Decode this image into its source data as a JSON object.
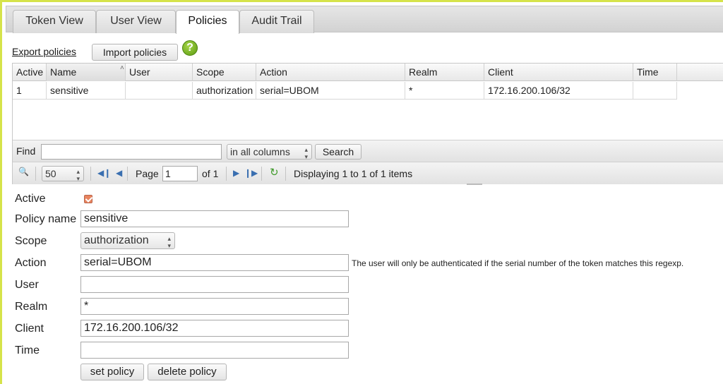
{
  "tabs": [
    {
      "label": "Token View",
      "active": false
    },
    {
      "label": "User View",
      "active": false
    },
    {
      "label": "Policies",
      "active": true
    },
    {
      "label": "Audit Trail",
      "active": false
    }
  ],
  "toolbar": {
    "export_label": "Export policies",
    "import_label": "Import policies",
    "help_icon": "help-icon",
    "help_glyph": "?"
  },
  "grid": {
    "columns": [
      "Active",
      "Name",
      "User",
      "Scope",
      "Action",
      "Realm",
      "Client",
      "Time"
    ],
    "sorted_column": "Name",
    "rows": [
      {
        "active": "1",
        "name": "sensitive",
        "user": "",
        "scope": "authorization",
        "action": "serial=UBOM",
        "realm": "*",
        "client": "172.16.200.106/32",
        "time": ""
      }
    ],
    "find": {
      "label": "Find",
      "value": "",
      "column_select": "in all columns",
      "search_label": "Search"
    },
    "pager": {
      "page_size": "50",
      "page_label": "Page",
      "page_value": "1",
      "of_label": "of 1",
      "status": "Displaying 1 to 1 of 1 items"
    }
  },
  "form": {
    "active_label": "Active",
    "active_checked": true,
    "policy_name_label": "Policy name",
    "policy_name_value": "sensitive",
    "scope_label": "Scope",
    "scope_value": "authorization",
    "action_label": "Action",
    "action_value": "serial=UBOM",
    "action_help": "The user will only be authenticated if the serial number of the token matches this regexp.",
    "user_label": "User",
    "user_value": "",
    "realm_label": "Realm",
    "realm_value": "*",
    "client_label": "Client",
    "client_value": "172.16.200.106/32",
    "time_label": "Time",
    "time_value": "",
    "set_label": "set policy",
    "delete_label": "delete policy"
  },
  "colors": {
    "frame_accent": "#d6e34a",
    "checkbox": "#e8845f",
    "help_icon": "#5b9a10",
    "pager_icons": "#3a6fb0"
  }
}
